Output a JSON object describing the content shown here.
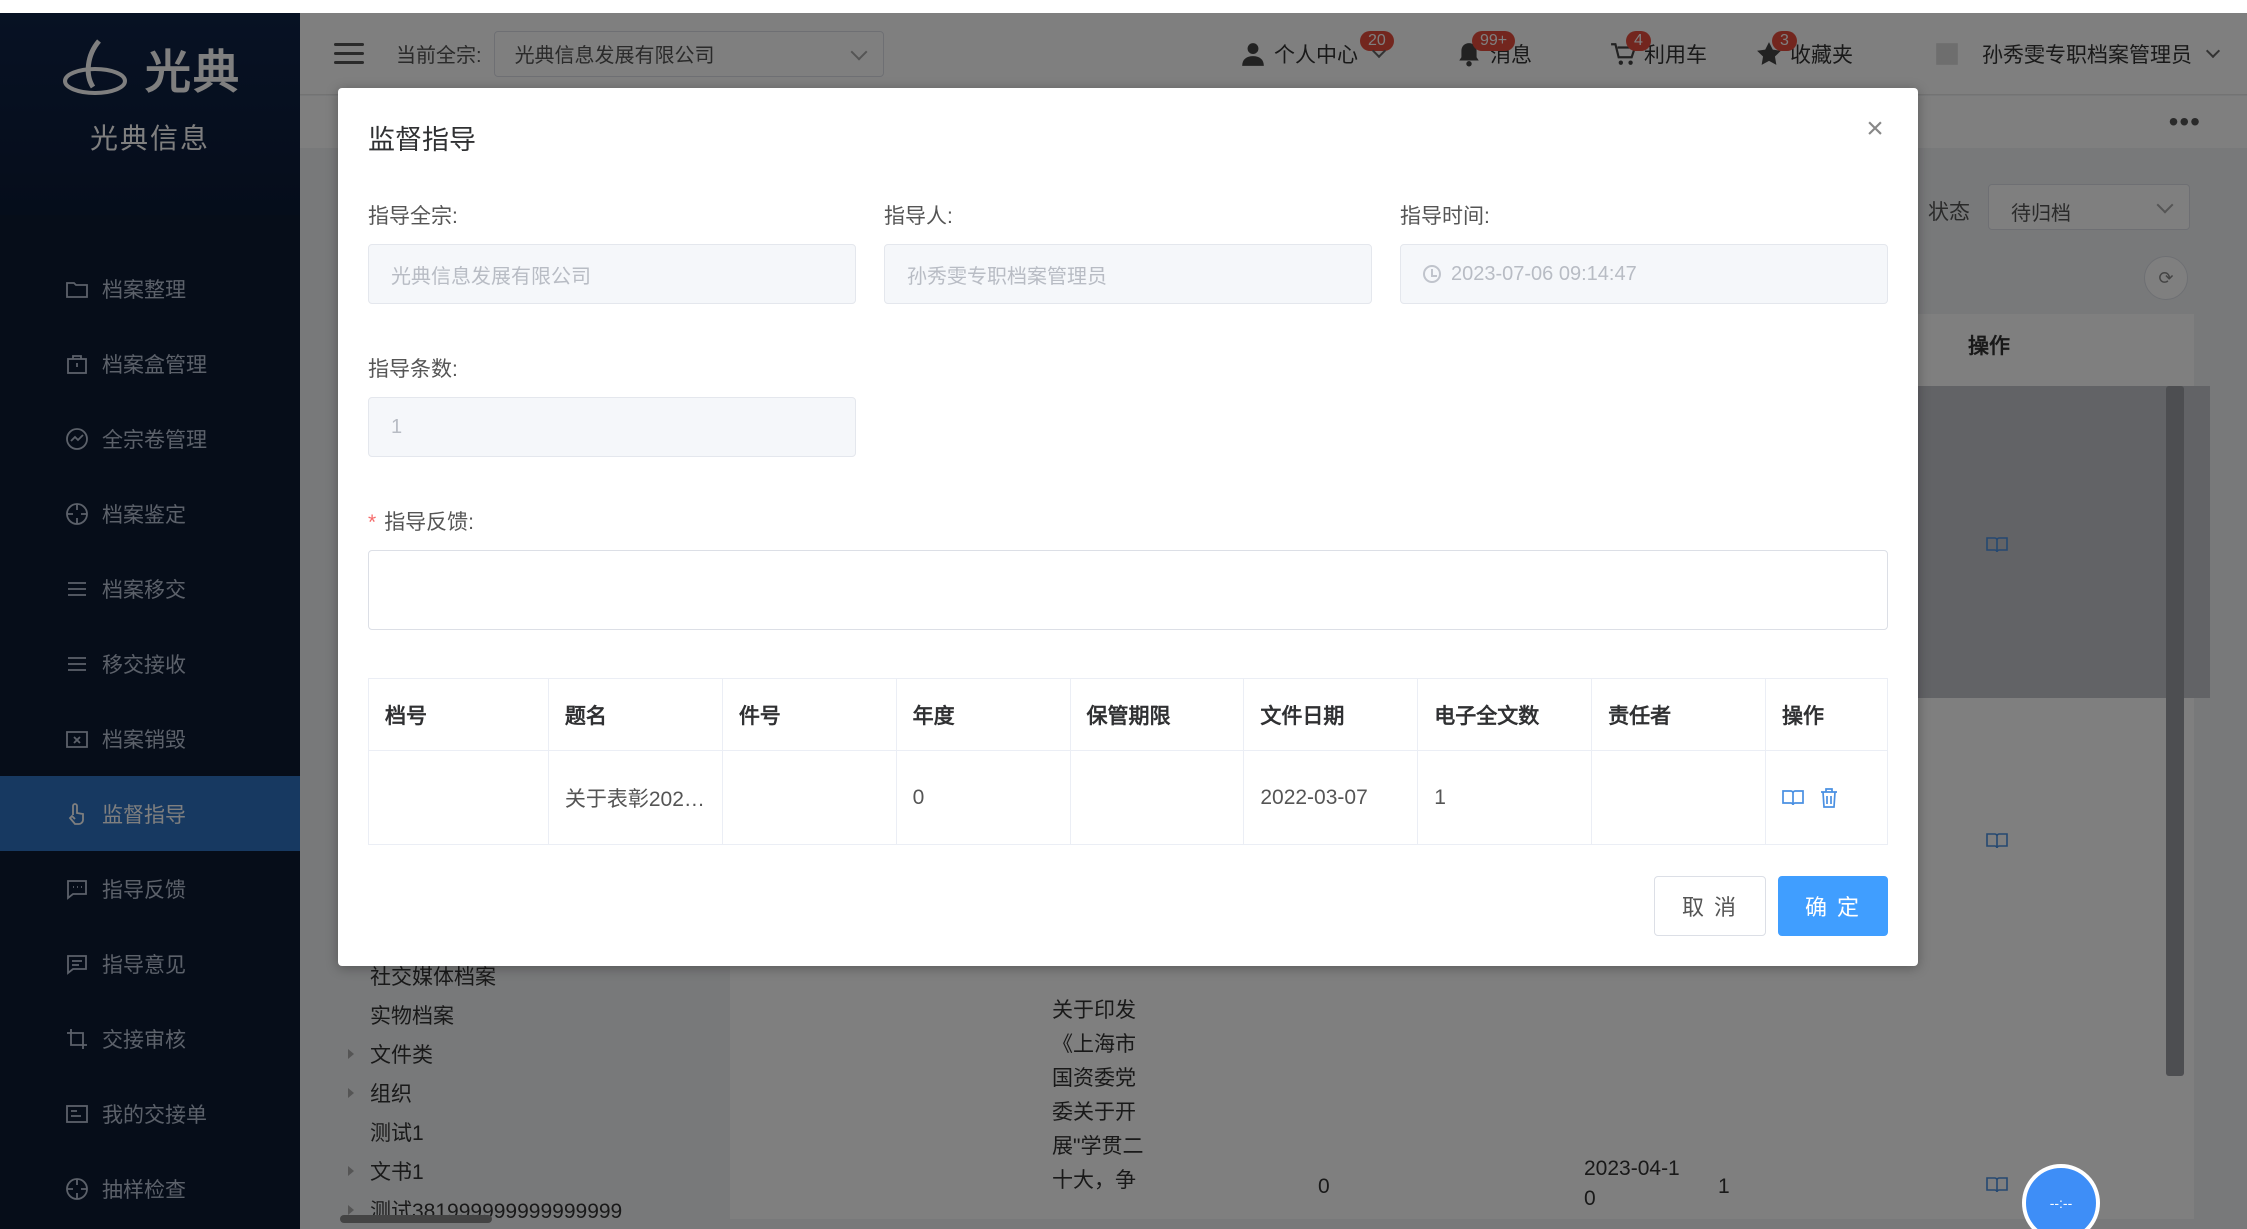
{
  "sidebar": {
    "logo_text": "光典",
    "logo_sub": "光典信息",
    "items": [
      {
        "label": "档案整理",
        "icon": "folder-icon"
      },
      {
        "label": "档案盒管理",
        "icon": "briefcase-icon"
      },
      {
        "label": "全宗卷管理",
        "icon": "chart-circle-icon"
      },
      {
        "label": "档案鉴定",
        "icon": "target-icon"
      },
      {
        "label": "档案移交",
        "icon": "list-icon"
      },
      {
        "label": "移交接收",
        "icon": "list-icon"
      },
      {
        "label": "档案销毁",
        "icon": "folder-x-icon"
      },
      {
        "label": "监督指导",
        "icon": "hand-icon",
        "active": true
      },
      {
        "label": "指导反馈",
        "icon": "chat-icon"
      },
      {
        "label": "指导意见",
        "icon": "comment-icon"
      },
      {
        "label": "交接审核",
        "icon": "crop-icon"
      },
      {
        "label": "我的交接单",
        "icon": "form-icon"
      },
      {
        "label": "抽样检查",
        "icon": "target-icon"
      }
    ]
  },
  "header": {
    "current_label": "当前全宗:",
    "current_value": "光典信息发展有限公司",
    "personal": "个人中心",
    "personal_badge": "20",
    "messages": "消息",
    "messages_badge": "99+",
    "cart": "利用车",
    "cart_badge": "4",
    "favorites": "收藏夹",
    "favorites_badge": "3",
    "user": "孙秀雯专职档案管理员"
  },
  "background": {
    "more": "•••",
    "status_label": "状态",
    "status_value": "待归档",
    "op_header": "操作",
    "tree": [
      "社交媒体档案",
      "实物档案",
      "文件类",
      "组织",
      "测试1",
      "文书1",
      "测试381999999999999999"
    ],
    "tree_expandable": [
      false,
      false,
      true,
      true,
      false,
      true,
      true
    ],
    "cell_title_lines": [
      "关于印发",
      "《上海市",
      "国资委党",
      "委关于开",
      "展\"学贯二",
      "十大，争"
    ],
    "cell_year": "0",
    "cell_date": "2023-04-1",
    "cell_date2": "0",
    "cell_count": "1",
    "float_ball": "--:--"
  },
  "dialog": {
    "title": "监督指导",
    "fonds_label": "指导全宗:",
    "fonds_value": "光典信息发展有限公司",
    "person_label": "指导人:",
    "person_value": "孙秀雯专职档案管理员",
    "time_label": "指导时间:",
    "time_value": "2023-07-06 09:14:47",
    "count_label": "指导条数:",
    "count_value": "1",
    "feedback_label": "指导反馈:",
    "feedback_value": "",
    "table": {
      "headers": [
        "档号",
        "题名",
        "件号",
        "年度",
        "保管期限",
        "文件日期",
        "电子全文数",
        "责任者",
        "操作"
      ],
      "rows": [
        [
          "",
          "关于表彰202…",
          "",
          "0",
          "",
          "2022-03-07",
          "1",
          ""
        ]
      ]
    },
    "cancel_label": "取 消",
    "ok_label": "确 定"
  }
}
